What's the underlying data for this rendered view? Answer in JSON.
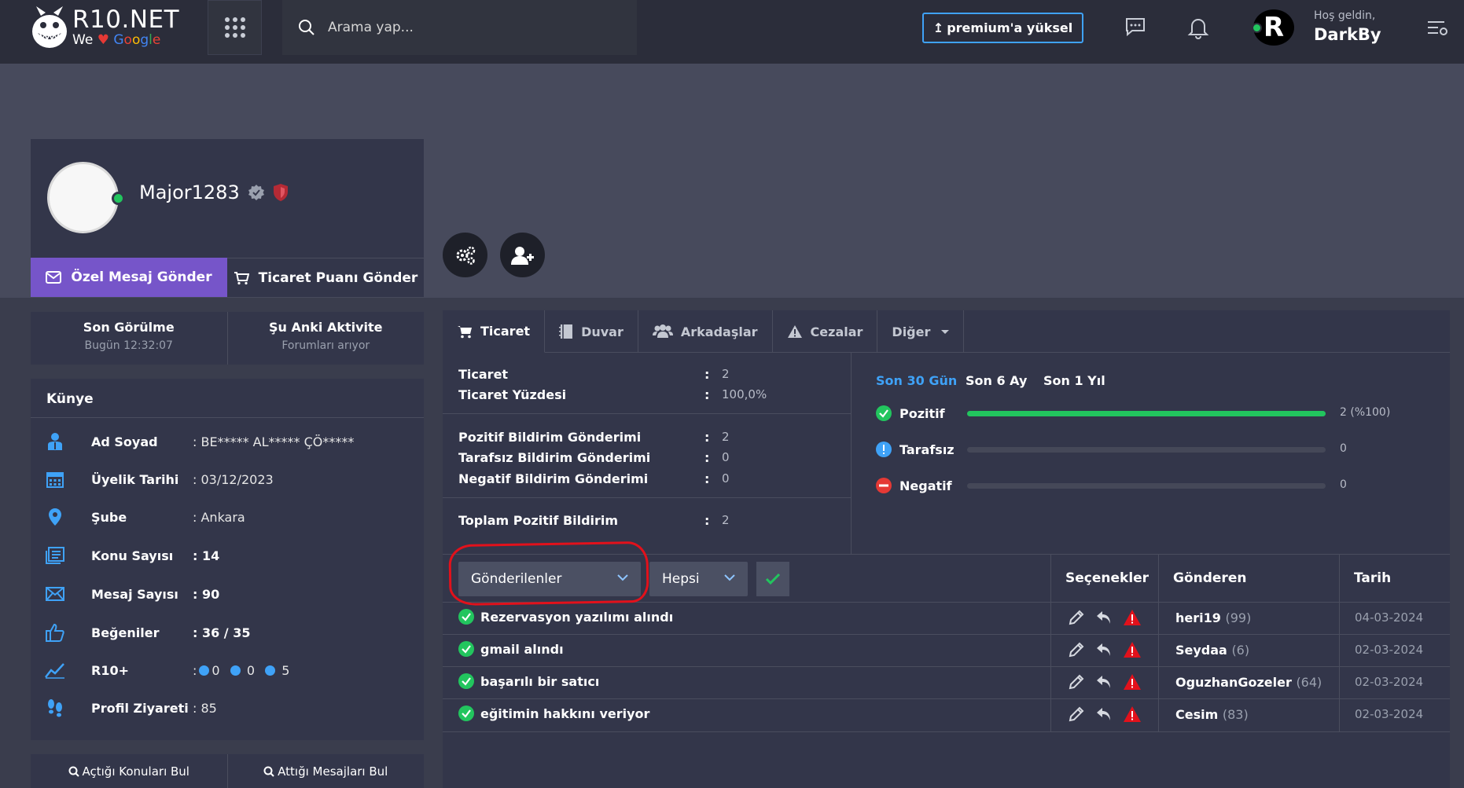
{
  "header": {
    "logo_name": "R10.NET",
    "logo_we": "We",
    "logo_google": [
      "G",
      "o",
      "o",
      "g",
      "l",
      "e"
    ],
    "search_placeholder": "Arama yap...",
    "premium_label": "premium'a yüksel",
    "user_initial": "R",
    "greet_sub": "Hoş geldin,",
    "greet_name": "DarkBy"
  },
  "profile": {
    "username": "Major1283",
    "pm_button": "Özel Mesaj Gönder",
    "trade_button": "Ticaret Puanı Gönder",
    "last_seen_title": "Son Görülme",
    "last_seen_value": "Bugün 12:32:07",
    "activity_title": "Şu Anki Aktivite",
    "activity_value": "Forumları arıyor"
  },
  "kunye": {
    "title": "Künye",
    "rows": [
      {
        "label": "Ad Soyad",
        "value": ": BE***** AL***** ÇÖ*****",
        "icon": "user-icon"
      },
      {
        "label": "Üyelik Tarihi",
        "value": ": 03/12/2023",
        "icon": "calendar-icon"
      },
      {
        "label": "Şube",
        "value": ": Ankara",
        "icon": "location-pin-icon"
      },
      {
        "label": "Konu Sayısı",
        "value": ": 14",
        "icon": "document-icon"
      },
      {
        "label": "Mesaj Sayısı",
        "value": ": 90",
        "icon": "envelope-icon"
      },
      {
        "label": "Beğeniler",
        "value": ": 36 / 35",
        "icon": "thumbs-up-icon"
      },
      {
        "label": "R10+",
        "values": [
          "0",
          "0",
          "5"
        ],
        "icon": "chart-line-icon"
      },
      {
        "label": "Profil Ziyareti",
        "value": ": 85",
        "icon": "footprints-icon"
      }
    ],
    "r10_colon": ":"
  },
  "find": {
    "topics": "Açtığı Konuları Bul",
    "messages": "Attığı Mesajları Bul"
  },
  "tabs": [
    {
      "label": "Ticaret",
      "icon": "cart-icon",
      "active": true
    },
    {
      "label": "Duvar",
      "icon": "notebook-icon"
    },
    {
      "label": "Arkadaşlar",
      "icon": "users-icon"
    },
    {
      "label": "Cezalar",
      "icon": "warning-icon"
    },
    {
      "label": "Diğer",
      "icon": "caret-down-icon"
    }
  ],
  "stats": [
    {
      "label": "Ticaret",
      "value": "2"
    },
    {
      "label": "Ticaret Yüzdesi",
      "value": "100,0%"
    },
    {
      "label": "Pozitif Bildirim Gönderimi",
      "value": "2"
    },
    {
      "label": "Tarafsız Bildirim Gönderimi",
      "value": "0"
    },
    {
      "label": "Negatif Bildirim Gönderimi",
      "value": "0"
    },
    {
      "label": "Toplam Pozitif Bildirim",
      "value": "2"
    }
  ],
  "stat_colon": ":",
  "periods": [
    "Son 30 Gün",
    "Son 6 Ay",
    "Son 1 Yıl"
  ],
  "feedback": [
    {
      "label": "Pozitif",
      "count": "2 (%100)",
      "fill": 1.0,
      "color": "#22c55e"
    },
    {
      "label": "Tarafsız",
      "count": "0",
      "fill": 0,
      "color": "#3fa2f7"
    },
    {
      "label": "Negatif",
      "count": "0",
      "fill": 0,
      "color": "#e53935"
    }
  ],
  "table": {
    "filter_selected": "Gönderilenler",
    "type_selected": "Hepsi",
    "col_options": "Seçenekler",
    "col_sender": "Gönderen",
    "col_date": "Tarih",
    "rows": [
      {
        "message": "Rezervasyon yazılımı alındı",
        "sender": "heri19",
        "count": "(99)",
        "date": "04-03-2024"
      },
      {
        "message": "gmail alındı",
        "sender": "Seydaa",
        "count": "(6)",
        "date": "02-03-2024"
      },
      {
        "message": "başarılı bir satıcı",
        "sender": "OguzhanGozeler",
        "count": "(64)",
        "date": "02-03-2024"
      },
      {
        "message": "eğitimin hakkını veriyor",
        "sender": "Cesim",
        "count": "(83)",
        "date": "02-03-2024"
      }
    ]
  }
}
